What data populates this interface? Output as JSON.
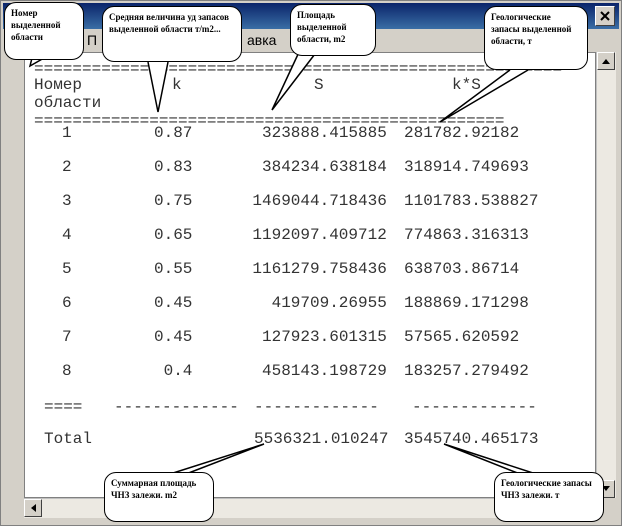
{
  "window": {
    "title": "",
    "menu": [
      "П",
      "авка"
    ]
  },
  "table": {
    "separator_top": "=======================================================",
    "headers": {
      "num": "Номер\nобласти",
      "k": "k",
      "s": "S",
      "ks": "k*S"
    },
    "separator_header": "=================================================",
    "rows": [
      {
        "num": "1",
        "k": "0.87",
        "s": "323888.415885",
        "ks": "281782.92182"
      },
      {
        "num": "2",
        "k": "0.83",
        "s": "384234.638184",
        "ks": "318914.749693"
      },
      {
        "num": "3",
        "k": "0.75",
        "s": "1469044.718436",
        "ks": "1101783.538827"
      },
      {
        "num": "4",
        "k": "0.65",
        "s": "1192097.409712",
        "ks": "774863.316313"
      },
      {
        "num": "5",
        "k": "0.55",
        "s": "1161279.758436",
        "ks": "638703.86714"
      },
      {
        "num": "6",
        "k": "0.45",
        "s": "419709.26955",
        "ks": "188869.171298"
      },
      {
        "num": "7",
        "k": "0.45",
        "s": "127923.601315",
        "ks": "57565.620592"
      },
      {
        "num": "8",
        "k": "0.4",
        "s": "458143.198729",
        "ks": "183257.279492"
      }
    ],
    "dash_num": "====",
    "dash_k": "-------------",
    "dash_s": "-------------",
    "dash_ks": "-------------",
    "total_label": "Total",
    "total_s": "5536321.010247",
    "total_ks": "3545740.465173"
  },
  "callouts": {
    "num": "Номер выделенной области",
    "k": "Средняя величина уд запасов выделенной области т/m2...",
    "s": "Площадь выделенной области, m2",
    "ks": "Геологические запасы выделенной области, т",
    "sum_s": "Суммарная площадь ЧНЗ залежи. m2",
    "sum_ks": "Геологические запасы ЧНЗ залежи. т"
  }
}
